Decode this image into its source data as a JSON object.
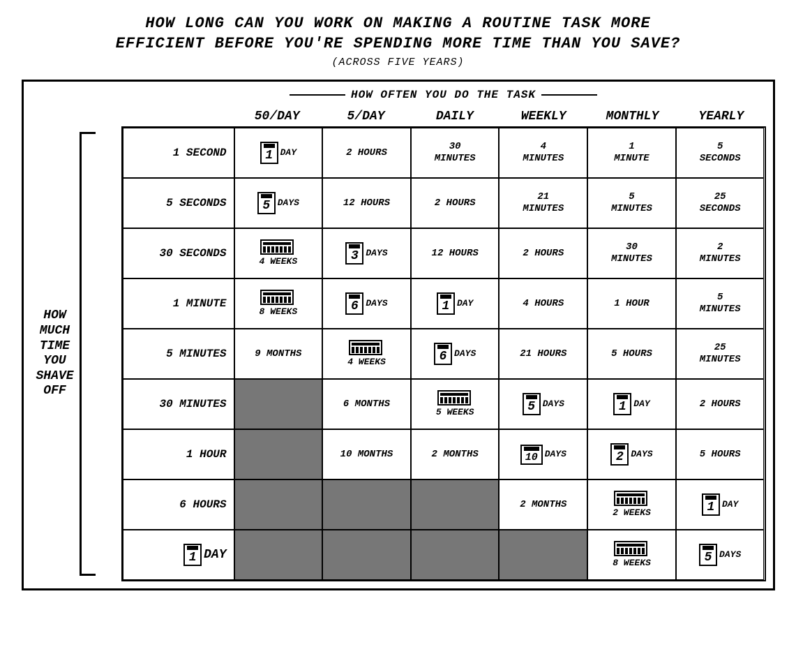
{
  "title": {
    "line1": "HOW LONG CAN YOU WORK ON MAKING A ROUTINE TASK MORE",
    "line2": "EFFICIENT BEFORE YOU'RE SPENDING MORE TIME THAN YOU SAVE?",
    "subtitle": "(ACROSS FIVE YEARS)"
  },
  "how_often_label": "HOW OFTEN YOU DO THE TASK",
  "columns": [
    "50/DAY",
    "5/DAY",
    "DAILY",
    "WEEKLY",
    "MONTHLY",
    "YEARLY"
  ],
  "left_label": [
    "HOW",
    "MUCH",
    "TIME",
    "YOU",
    "SHAVE",
    "OFF"
  ],
  "rows": [
    {
      "label": "1 SECOND",
      "cells": [
        {
          "type": "cal",
          "num": "1",
          "text": "DAY",
          "dark": false
        },
        {
          "type": "plain",
          "line1": "2 HOURS",
          "line2": "",
          "dark": false
        },
        {
          "type": "plain",
          "line1": "30",
          "line2": "MINUTES",
          "dark": false
        },
        {
          "type": "plain",
          "line1": "4",
          "line2": "MINUTES",
          "dark": false
        },
        {
          "type": "plain",
          "line1": "1",
          "line2": "MINUTE",
          "dark": false
        },
        {
          "type": "plain",
          "line1": "5",
          "line2": "SECONDS",
          "dark": false
        }
      ]
    },
    {
      "label": "5 SECONDS",
      "cells": [
        {
          "type": "cal",
          "num": "5",
          "text": "DAYS",
          "dark": false
        },
        {
          "type": "plain",
          "line1": "12 HOURS",
          "line2": "",
          "dark": false
        },
        {
          "type": "plain",
          "line1": "2 HOURS",
          "line2": "",
          "dark": false
        },
        {
          "type": "plain",
          "line1": "21",
          "line2": "MINUTES",
          "dark": false
        },
        {
          "type": "plain",
          "line1": "5",
          "line2": "MINUTES",
          "dark": false
        },
        {
          "type": "plain",
          "line1": "25",
          "line2": "SECONDS",
          "dark": false
        }
      ]
    },
    {
      "label": "30 SECONDS",
      "cells": [
        {
          "type": "prog",
          "text": "4 WEEKS",
          "dark": false
        },
        {
          "type": "cal",
          "num": "3",
          "text": "DAYS",
          "dark": false
        },
        {
          "type": "plain",
          "line1": "12 HOURS",
          "line2": "",
          "dark": false
        },
        {
          "type": "plain",
          "line1": "2 HOURS",
          "line2": "",
          "dark": false
        },
        {
          "type": "plain",
          "line1": "30",
          "line2": "MINUTES",
          "dark": false
        },
        {
          "type": "plain",
          "line1": "2",
          "line2": "MINUTES",
          "dark": false
        }
      ]
    },
    {
      "label": "1 MINUTE",
      "cells": [
        {
          "type": "prog",
          "text": "8 WEEKS",
          "dark": false
        },
        {
          "type": "cal",
          "num": "6",
          "text": "DAYS",
          "dark": false
        },
        {
          "type": "cal",
          "num": "1",
          "text": "DAY",
          "dark": false
        },
        {
          "type": "plain",
          "line1": "4 HOURS",
          "line2": "",
          "dark": false
        },
        {
          "type": "plain",
          "line1": "1 HOUR",
          "line2": "",
          "dark": false
        },
        {
          "type": "plain",
          "line1": "5",
          "line2": "MINUTES",
          "dark": false
        }
      ]
    },
    {
      "label": "5 MINUTES",
      "cells": [
        {
          "type": "plain",
          "line1": "9 MONTHS",
          "line2": "",
          "dark": false
        },
        {
          "type": "prog",
          "text": "4 WEEKS",
          "dark": false
        },
        {
          "type": "cal",
          "num": "6",
          "text": "DAYS",
          "dark": false
        },
        {
          "type": "plain",
          "line1": "21 HOURS",
          "line2": "",
          "dark": false
        },
        {
          "type": "plain",
          "line1": "5 HOURS",
          "line2": "",
          "dark": false
        },
        {
          "type": "plain",
          "line1": "25",
          "line2": "MINUTES",
          "dark": false
        }
      ]
    },
    {
      "label": "30 MINUTES",
      "cells": [
        {
          "type": "plain",
          "line1": "",
          "line2": "",
          "dark": true
        },
        {
          "type": "plain",
          "line1": "6 MONTHS",
          "line2": "",
          "dark": false
        },
        {
          "type": "prog",
          "text": "5 WEEKS",
          "dark": false
        },
        {
          "type": "cal",
          "num": "5",
          "text": "DAYS",
          "dark": false
        },
        {
          "type": "cal",
          "num": "1",
          "text": "DAY",
          "dark": false
        },
        {
          "type": "plain",
          "line1": "2 HOURS",
          "line2": "",
          "dark": false
        }
      ]
    },
    {
      "label": "1 HOUR",
      "cells": [
        {
          "type": "plain",
          "line1": "",
          "line2": "",
          "dark": true
        },
        {
          "type": "plain",
          "line1": "10 MONTHS",
          "line2": "",
          "dark": false
        },
        {
          "type": "plain",
          "line1": "2 MONTHS",
          "line2": "",
          "dark": false
        },
        {
          "type": "cal",
          "num": "10",
          "text": "DAYS",
          "dark": false
        },
        {
          "type": "cal",
          "num": "2",
          "text": "DAYS",
          "dark": false
        },
        {
          "type": "plain",
          "line1": "5 HOURS",
          "line2": "",
          "dark": false
        }
      ]
    },
    {
      "label": "6 HOURS",
      "cells": [
        {
          "type": "plain",
          "line1": "",
          "line2": "",
          "dark": true
        },
        {
          "type": "plain",
          "line1": "",
          "line2": "",
          "dark": true
        },
        {
          "type": "plain",
          "line1": "",
          "line2": "",
          "dark": true
        },
        {
          "type": "plain",
          "line1": "2 MONTHS",
          "line2": "",
          "dark": false
        },
        {
          "type": "prog",
          "text": "2 WEEKS",
          "dark": false
        },
        {
          "type": "cal",
          "num": "1",
          "text": "DAY",
          "dark": false
        }
      ]
    },
    {
      "label_cal": true,
      "label_num": "1",
      "label_text": "DAY",
      "cells": [
        {
          "type": "plain",
          "line1": "",
          "line2": "",
          "dark": true
        },
        {
          "type": "plain",
          "line1": "",
          "line2": "",
          "dark": true
        },
        {
          "type": "plain",
          "line1": "",
          "line2": "",
          "dark": true
        },
        {
          "type": "plain",
          "line1": "",
          "line2": "",
          "dark": true
        },
        {
          "type": "prog",
          "text": "8 WEEKS",
          "dark": false
        },
        {
          "type": "cal",
          "num": "5",
          "text": "DAYS",
          "dark": false
        }
      ]
    }
  ]
}
